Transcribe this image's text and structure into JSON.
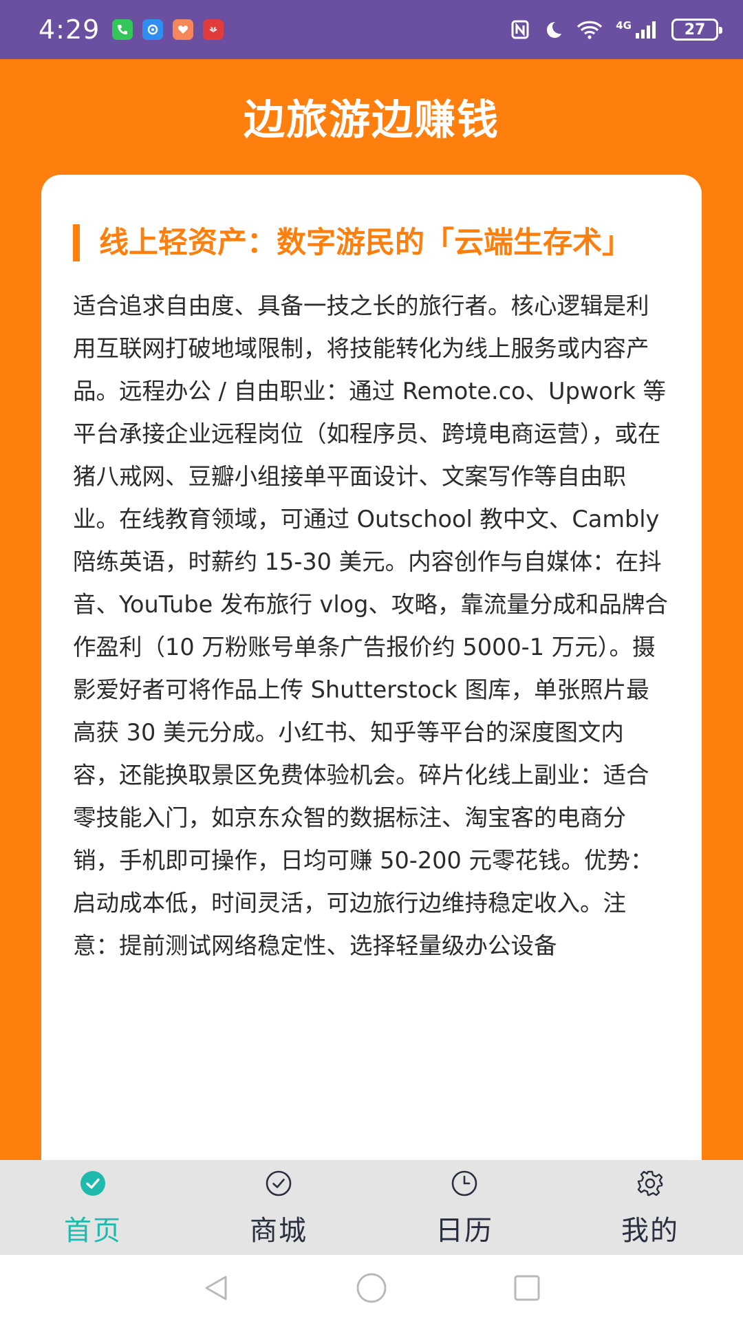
{
  "status_bar": {
    "time": "4:29",
    "battery": "27",
    "network": "4G",
    "app_icons": [
      {
        "name": "phone-app-icon",
        "color": "#33c75a"
      },
      {
        "name": "chat-app-icon",
        "color": "#2f8ff0"
      },
      {
        "name": "health-app-icon",
        "color": "#f5875a"
      },
      {
        "name": "huawei-app-icon",
        "color": "#e23b3b"
      }
    ]
  },
  "header": {
    "title": "边旅游边赚钱"
  },
  "article": {
    "heading": "线上轻资产：数字游民的「云端生存术」",
    "body": "适合追求自由度、具备一技之长的旅行者。核心逻辑是利用互联网打破地域限制，将技能转化为线上服务或内容产品。远程办公 / 自由职业：通过 Remote.co、Upwork 等平台承接企业远程岗位（如程序员、跨境电商运营），或在猪八戒网、豆瓣小组接单平面设计、文案写作等自由职业。在线教育领域，可通过 Outschool 教中文、Cambly 陪练英语，时薪约 15-30 美元。内容创作与自媒体：在抖音、YouTube 发布旅行 vlog、攻略，靠流量分成和品牌合作盈利（10 万粉账号单条广告报价约 5000-1 万元）。摄影爱好者可将作品上传 Shutterstock 图库，单张照片最高获 30 美元分成。小红书、知乎等平台的深度图文内容，还能换取景区免费体验机会。碎片化线上副业：适合零技能入门，如京东众智的数据标注、淘宝客的电商分销，手机即可操作，日均可赚 50-200 元零花钱。优势：启动成本低，时间灵活，可边旅行边维持稳定收入。注意：提前测试网络稳定性、选择轻量级办公设备"
  },
  "tabs": [
    {
      "label": "首页",
      "icon": "check-circle-filled-icon",
      "active": true
    },
    {
      "label": "商城",
      "icon": "check-circle-outline-icon",
      "active": false
    },
    {
      "label": "日历",
      "icon": "clock-icon",
      "active": false
    },
    {
      "label": "我的",
      "icon": "gear-icon",
      "active": false
    }
  ],
  "colors": {
    "status_bar": "#6b4fa1",
    "background": "#fe7f0e",
    "accent": "#fe7f0e",
    "tab_active": "#1fb9ad",
    "tab_inactive": "#2a2f3f",
    "tabbar_bg": "#e4e4e4"
  }
}
